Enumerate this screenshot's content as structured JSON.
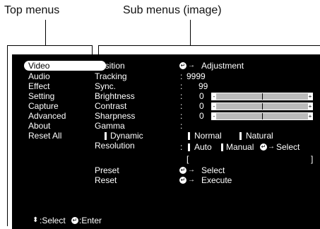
{
  "callouts": {
    "top_menus": "Top menus",
    "sub_menus": "Sub menus (image)"
  },
  "menu": {
    "items": [
      "Video",
      "Audio",
      "Effect",
      "Setting",
      "Capture",
      "Advanced",
      "About",
      "Reset All"
    ],
    "selected": "Video"
  },
  "sub": {
    "position": {
      "label": "Position",
      "value": "Adjustment"
    },
    "tracking": {
      "label": "Tracking",
      "value": "9999"
    },
    "sync": {
      "label": "Sync.",
      "value": "99"
    },
    "brightness": {
      "label": "Brightness",
      "value": "0",
      "level": 0.5
    },
    "contrast": {
      "label": "Contrast",
      "value": "0",
      "level": 0.5
    },
    "sharpness": {
      "label": "Sharpness",
      "value": "0",
      "level": 0.5
    },
    "gamma": {
      "label": "Gamma",
      "dynamic": "Dynamic",
      "normal": "Normal",
      "natural": "Natural"
    },
    "resolution": {
      "label": "Resolution",
      "auto": "Auto",
      "manual": "Manual",
      "select": "Select",
      "bracket_open": "[",
      "bracket_close": "]"
    },
    "preset": {
      "label": "Preset",
      "value": "Select"
    },
    "reset": {
      "label": "Reset",
      "value": "Execute"
    }
  },
  "colon": ":",
  "footer": {
    "select": ":Select",
    "enter": ":Enter"
  },
  "colors": {
    "screen_bg": "#000000",
    "text": "#ffffff",
    "slider_fill": "#bbbbbb"
  }
}
